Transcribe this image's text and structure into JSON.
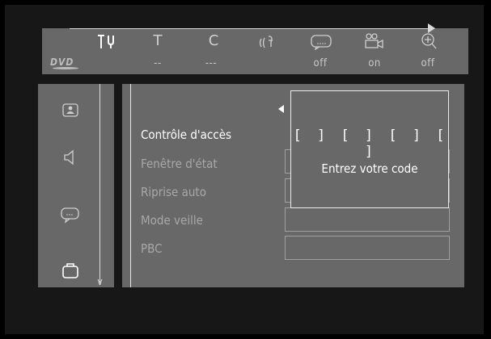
{
  "top_bar": {
    "icons": [
      {
        "name": "settings-tools-icon",
        "active": true
      },
      {
        "name": "title-icon",
        "glyph": "T"
      },
      {
        "name": "chapter-icon",
        "glyph": "C"
      },
      {
        "name": "audio-icon"
      },
      {
        "name": "subtitle-icon"
      },
      {
        "name": "camera-angle-icon"
      },
      {
        "name": "zoom-icon"
      }
    ],
    "disc_logo": "DVD",
    "values": [
      "--",
      "---",
      "off",
      "on",
      "off"
    ]
  },
  "side_menu": {
    "icons": [
      "picture-icon",
      "speaker-icon",
      "chat-bubble-icon",
      "briefcase-icon"
    ],
    "selected": "briefcase-icon"
  },
  "menu": {
    "items": [
      "Contrôle d'accès",
      "Fenêtre d'état",
      "Riprise auto",
      "Mode veille",
      "PBC"
    ],
    "selected_index": 0
  },
  "code_popup": {
    "code_display": "[ ] [ ] [ ] [ ]",
    "prompt": "Entrez votre code"
  },
  "colors": {
    "background": "#000000",
    "screen": "#171717",
    "panel": "#686868",
    "text_active": "#ffffff",
    "text_inactive": "#a8a8a8"
  }
}
